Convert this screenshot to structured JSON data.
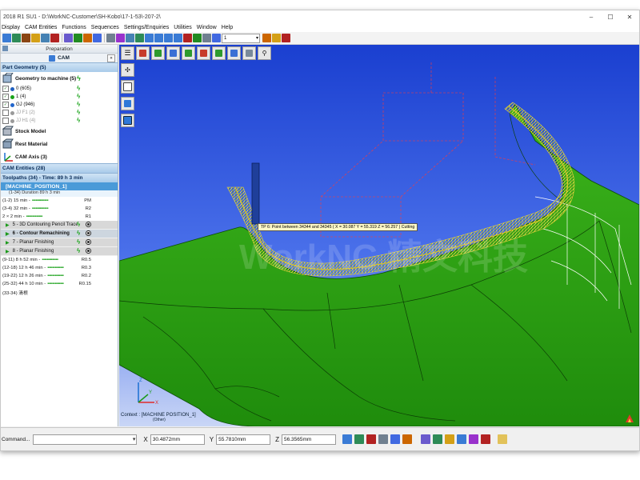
{
  "window": {
    "title": "2018 R1 SU1 - D:\\WorkNC-Customer\\SH-Kobo\\17-1-53\\-207-2\\",
    "buttons": [
      "–",
      "☐",
      "✕"
    ]
  },
  "menu": [
    "Display",
    "CAM Entities",
    "Functions",
    "Sequences",
    "Settings/Enquiries",
    "Utilities",
    "Window",
    "Help"
  ],
  "toolbar": {
    "combo_value": "1",
    "colors": [
      "#3a7bd5",
      "#2e8b57",
      "#8b4513",
      "#d4a017",
      "#4682b4",
      "#b22222",
      "#6a5acd",
      "#228b22",
      "#cc6600",
      "#4169e1",
      "#708090",
      "#9932cc"
    ]
  },
  "left_panel": {
    "header": "Preparation",
    "cam_tab": "CAM",
    "part_geometry": "Part Geometry (5)",
    "geometry_to_machine": "Geometry to machine (5)",
    "geometry_items": [
      {
        "label": "0 (605)",
        "color": "#1f5fbf",
        "checked": true
      },
      {
        "label": "1 (4)",
        "color": "#19a319",
        "checked": true
      },
      {
        "label": "GJ (946)",
        "color": "#2266cc",
        "checked": true
      },
      {
        "label": "JJ F1 (2)",
        "color": "#9a9a9a",
        "checked": false
      },
      {
        "label": "JJ H1 (4)",
        "color": "#9a9a9a",
        "checked": false
      }
    ],
    "stock_model": "Stock Model",
    "rest_material": "Rest Material",
    "cam_axis": "CAM Axis (3)",
    "cam_entities": "CAM Entities (28)",
    "toolpaths_header": "Toolpaths (34) - Time: 89 h 3 min",
    "machine_position": "[MACHINE_POSITION_1]",
    "duration": "(1-34) Duration 89 h 3 min",
    "groups_top": [
      {
        "label": "(1-2) 15 min -",
        "tail": "PM"
      },
      {
        "label": "(3-4) 32 min -",
        "tail": "R2"
      },
      {
        "label": "2 × 2 min -",
        "tail": "R1"
      }
    ],
    "operations": [
      {
        "label": "5 - 3D Contouring Pencil Trace",
        "selected": false
      },
      {
        "label": "6 - Contour Remachining",
        "selected": true
      },
      {
        "label": "7 - Planar Finishing",
        "selected": false
      },
      {
        "label": "8 - Planar Finishing",
        "selected": false
      }
    ],
    "groups_bottom": [
      {
        "label": "(9-11) 8 h 52 min -",
        "tail": "R0.5"
      },
      {
        "label": "(12-18) 12 h 46 min -",
        "tail": "R0.3"
      },
      {
        "label": "(19-22) 12 h 26 min -",
        "tail": "R0.2"
      },
      {
        "label": "(25-32) 44 h 10 min -",
        "tail": "R0.15"
      },
      {
        "label": "(33-34) 清根",
        "tail": ""
      }
    ]
  },
  "viewport": {
    "tooltip": "TP 6: Point between 34344 and 34345 ( X = 30.087  Y = 55.319  Z = 56.257 ) Cutting",
    "context_label": "Context : [MACHINE POSITION_1]",
    "context_sub": "(Other)",
    "watermark": "WorkNC 精文科技"
  },
  "status": {
    "command_label": "Command...",
    "x_label": "X",
    "x_value": "30.4872mm",
    "y_label": "Y",
    "y_value": "55.7810mm",
    "z_label": "Z",
    "z_value": "56.3565mm"
  }
}
